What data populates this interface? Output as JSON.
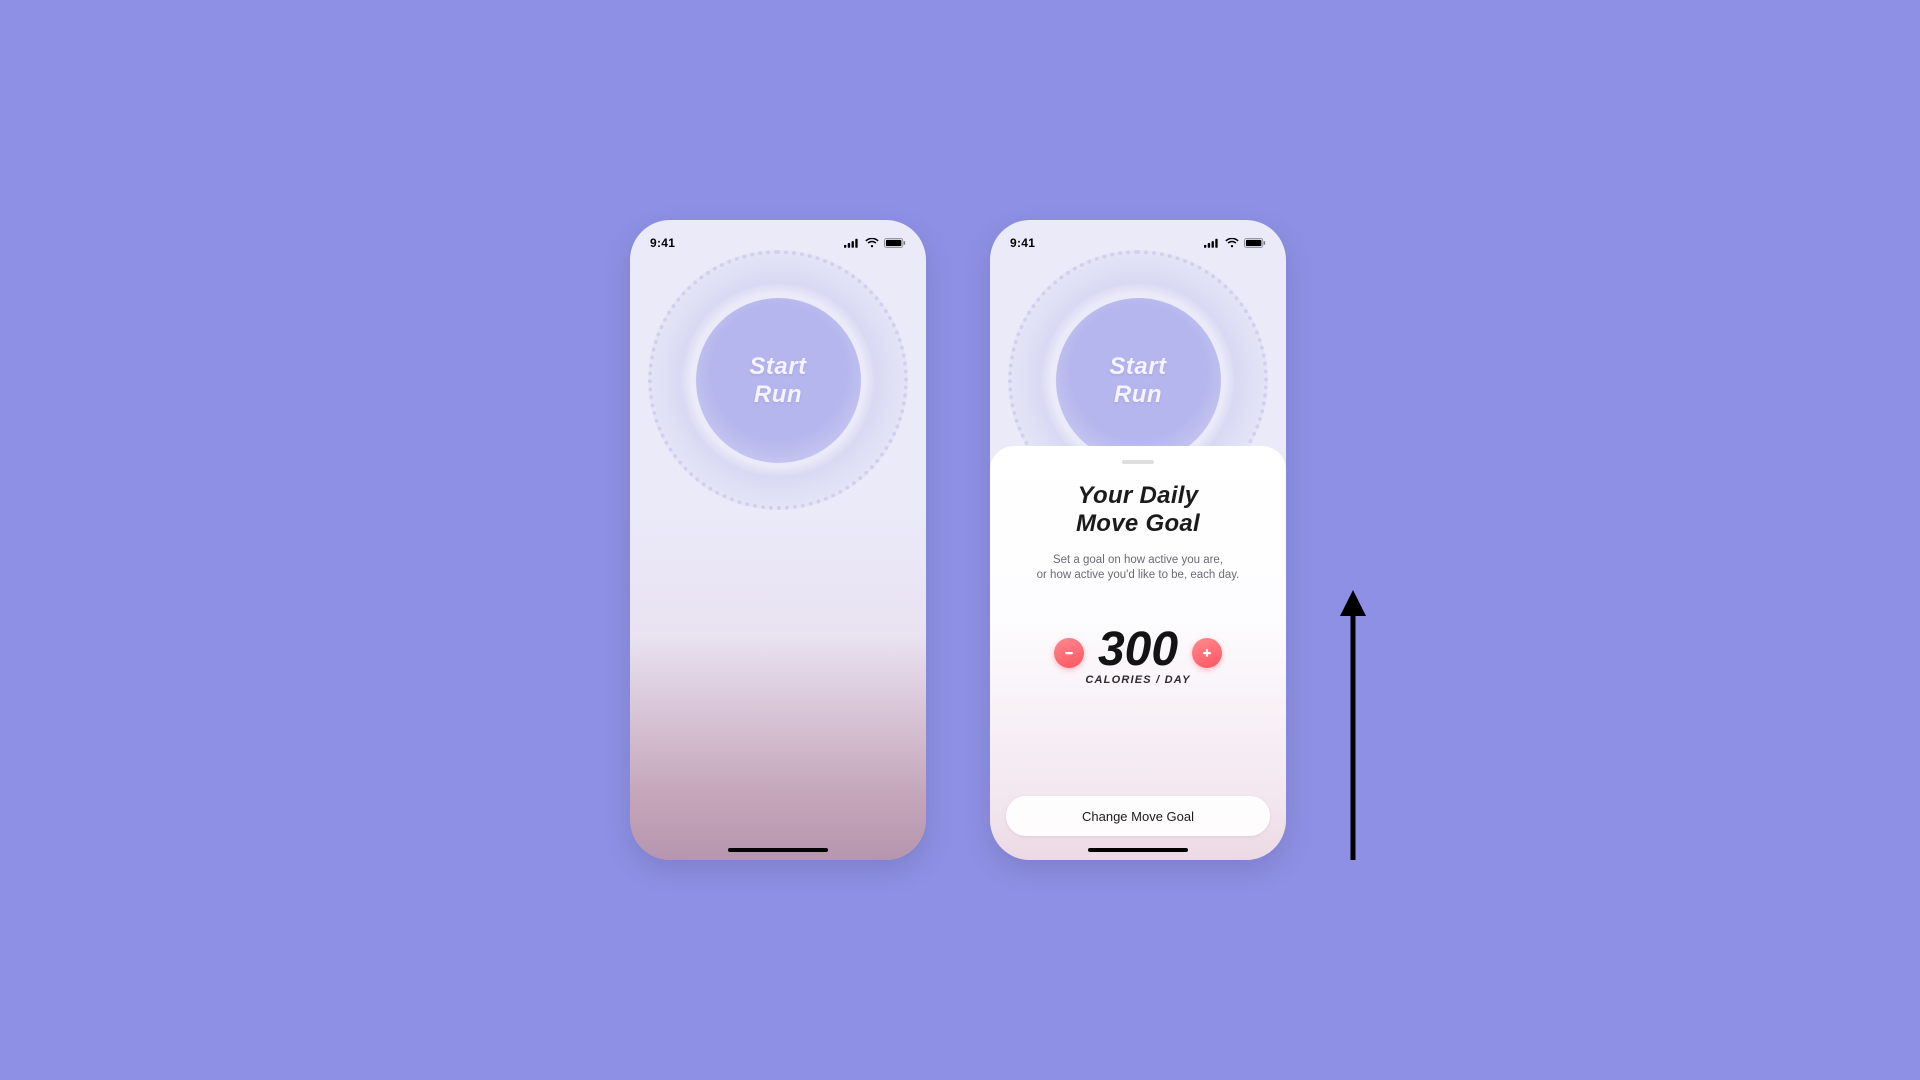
{
  "statusbar": {
    "time": "9:41"
  },
  "hero": {
    "start_label": "Start\nRun"
  },
  "sheet": {
    "title": "Your Daily\nMove Goal",
    "description": "Set a goal on how active you are,\nor how active you'd like to be, each day.",
    "calorie_value": "300",
    "calorie_unit": "CALORIES / DAY",
    "change_button_label": "Change Move Goal"
  },
  "colors": {
    "background": "#8e90e5",
    "accent": "#ff5560"
  }
}
